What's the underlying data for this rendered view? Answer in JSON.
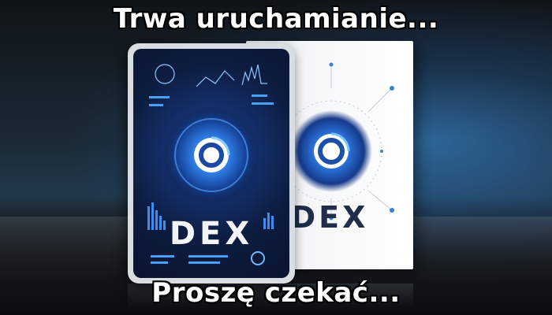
{
  "loading": {
    "title": "Trwa uruchamianie...",
    "subtitle": "Proszę czekać..."
  },
  "product": {
    "front_logo_text": "DEX",
    "back_logo_text": "DEX"
  },
  "colors": {
    "accent": "#2f7de0",
    "caption_text": "#ffffff",
    "caption_outline": "#000000",
    "logo_dark": "#1f2c4a"
  },
  "icons": [
    "dex-logo-icon"
  ]
}
